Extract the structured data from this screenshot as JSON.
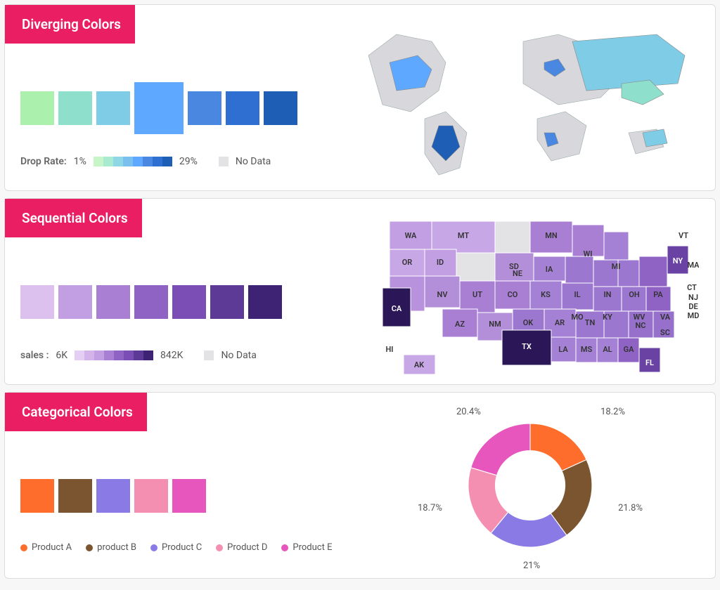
{
  "panels": {
    "diverging": {
      "title": "Diverging Colors",
      "swatches": [
        "#abf0ac",
        "#8ee0cc",
        "#7fcce6",
        "#5ea8ff",
        "#4a87e0",
        "#2f6fd2",
        "#1e5fb5"
      ],
      "highlight_index": 3,
      "legend_key": "Drop Rate:",
      "low": "1%",
      "high": "29%",
      "gradient": [
        "#c7f5c7",
        "#a9ebd0",
        "#8fd7e6",
        "#7ac0ee",
        "#5ea8ff",
        "#4a87e0",
        "#2f6fd2",
        "#1e5fb5"
      ],
      "no_data_label": "No Data",
      "map_note": "world choropleth"
    },
    "sequential": {
      "title": "Sequential Colors",
      "swatches": [
        "#dcc1ee",
        "#c29ee3",
        "#a97fd4",
        "#8f63c4",
        "#7a4eb4",
        "#5e3a97",
        "#3e2374"
      ],
      "legend_key": "sales :",
      "low": "6K",
      "high": "842K",
      "gradient": [
        "#e5cef3",
        "#d4b3ea",
        "#c29ee3",
        "#a97fd4",
        "#8f63c4",
        "#7a4eb4",
        "#5e3a97",
        "#3e2374"
      ],
      "no_data_label": "No Data",
      "state_labels": [
        "WA",
        "MT",
        "MN",
        "VT",
        "OR",
        "ID",
        "SD",
        "WI",
        "NY",
        "MA",
        "MI",
        "NV",
        "UT",
        "CO",
        "NE",
        "IA",
        "IL",
        "IN",
        "OH",
        "PA",
        "CT",
        "NJ",
        "DE",
        "MD",
        "CA",
        "KS",
        "MO",
        "KY",
        "WV",
        "VA",
        "AZ",
        "NM",
        "OK",
        "AR",
        "TN",
        "NC",
        "TX",
        "LA",
        "MS",
        "AL",
        "GA",
        "SC",
        "HI",
        "AK",
        "FL"
      ]
    },
    "categorical": {
      "title": "Categorical Colors",
      "swatches": [
        "#ff6d2d",
        "#7b5530",
        "#8a7ae6",
        "#f48fb1",
        "#e756bc"
      ],
      "products": [
        "Product A",
        "product B",
        "Product C",
        "Product D",
        "Product E"
      ]
    }
  },
  "chart_data": {
    "type": "pie",
    "title": "Product share",
    "series": [
      {
        "name": "Product A",
        "value": 18.2,
        "color": "#ff6d2d"
      },
      {
        "name": "product B",
        "value": 21.8,
        "color": "#7b5530"
      },
      {
        "name": "Product C",
        "value": 21.0,
        "color": "#8a7ae6"
      },
      {
        "name": "Product D",
        "value": 18.7,
        "color": "#f48fb1"
      },
      {
        "name": "Product E",
        "value": 20.4,
        "color": "#e756bc"
      }
    ],
    "labels": [
      "18.2%",
      "21.8%",
      "21%",
      "18.7%",
      "20.4%"
    ]
  }
}
